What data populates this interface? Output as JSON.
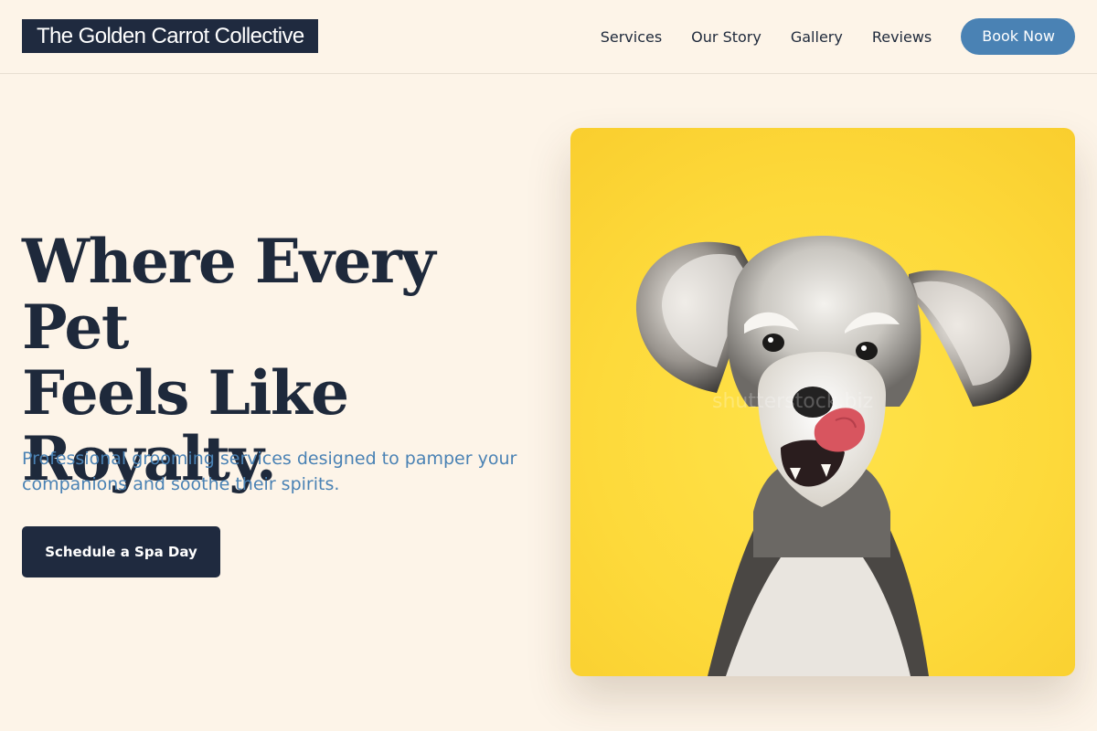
{
  "header": {
    "logo_text": "The Golden Carrot Collective",
    "nav": [
      {
        "label": "Services"
      },
      {
        "label": "Our Story"
      },
      {
        "label": "Gallery"
      },
      {
        "label": "Reviews"
      }
    ],
    "book_label": "Book Now"
  },
  "hero": {
    "title_lines": [
      "Where Every Pet",
      "Feels Like",
      "Royalty."
    ],
    "subtitle": "Professional grooming services designed to pamper your companions and soothe their spirits.",
    "cta_label": "Schedule a Spa Day",
    "image_watermark": "shutterstock.biz"
  },
  "colors": {
    "background": "#fdf4e8",
    "navy": "#1f2a3f",
    "accent_blue": "#4a82b4",
    "image_yellow": "#fdd93a"
  },
  "icons": {
    "hero_image": "schnauzer-dog-photo"
  }
}
